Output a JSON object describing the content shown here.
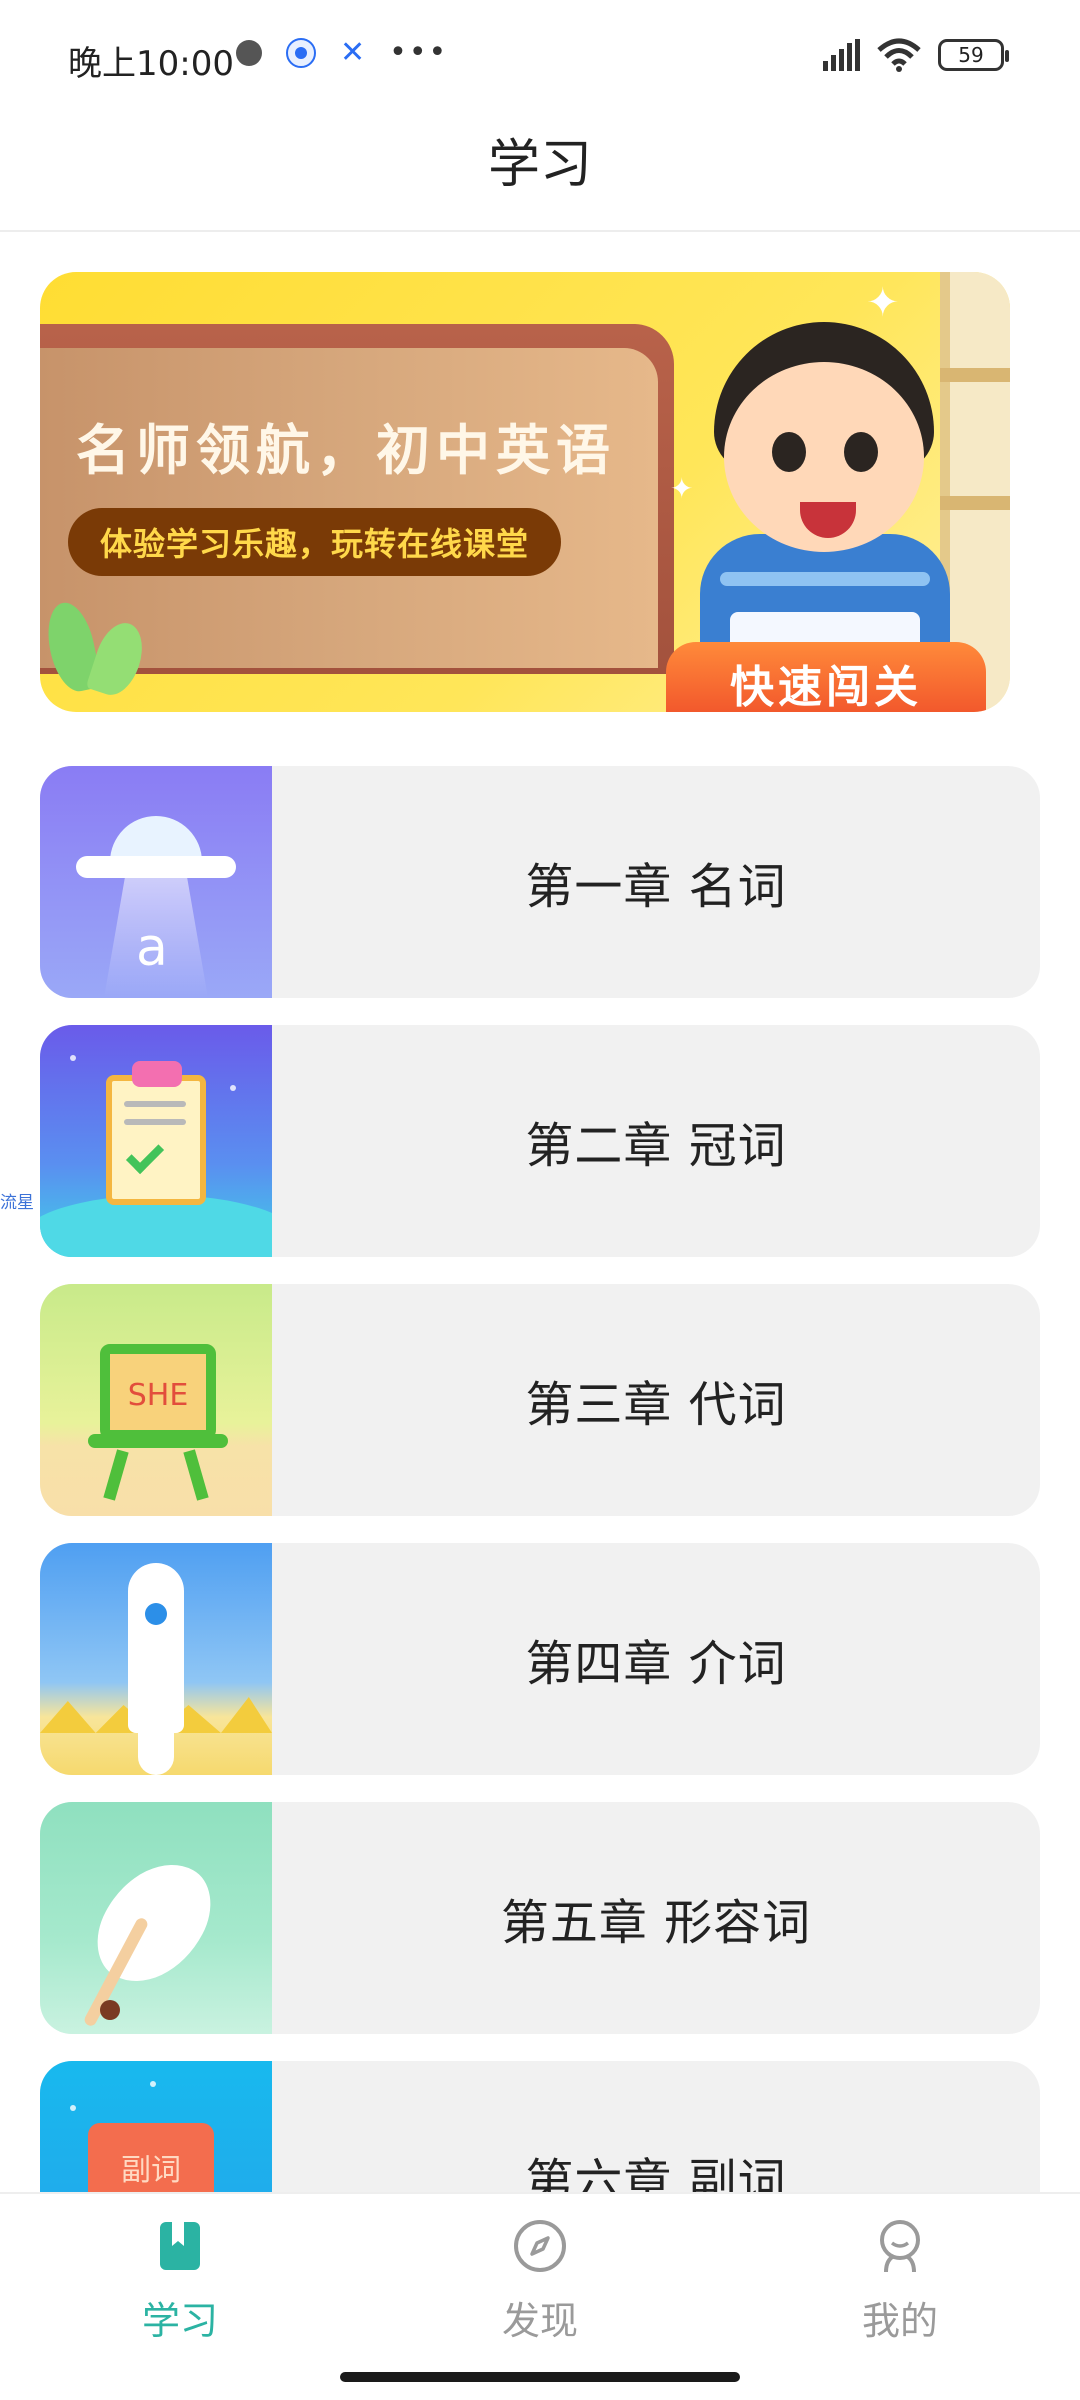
{
  "status_bar": {
    "time": "晚上10:00",
    "battery": "59",
    "icons": [
      "camera-dot-icon",
      "baidu-paw-icon",
      "x-app-icon",
      "more-dots-icon",
      "hd-signal-icon",
      "wifi-icon",
      "battery-icon"
    ]
  },
  "header": {
    "title": "学习"
  },
  "banner": {
    "title": "名师领航，初中英语",
    "subtitle": "体验学习乐趣，玩转在线课堂",
    "button_label": "快速闯关",
    "colors": {
      "background": "#ffdd33",
      "board": "#a3523d",
      "pill": "#7a3a06",
      "button": "#f0502a"
    }
  },
  "chapters": [
    {
      "label": "第一章 名词",
      "thumb_text": "a"
    },
    {
      "label": "第二章 冠词",
      "thumb_text": ""
    },
    {
      "label": "第三章 代词",
      "thumb_text": "SHE"
    },
    {
      "label": "第四章 介词",
      "thumb_text": ""
    },
    {
      "label": "第五章 形容词",
      "thumb_text": ""
    },
    {
      "label": "第六章 副词",
      "thumb_text": "副词"
    }
  ],
  "side_watermark": "流星",
  "bottom_nav": {
    "items": [
      {
        "label": "学习",
        "icon": "book-icon",
        "active": true
      },
      {
        "label": "发现",
        "icon": "compass-icon",
        "active": false
      },
      {
        "label": "我的",
        "icon": "person-icon",
        "active": false
      }
    ],
    "accent_color": "#2bb3a3",
    "inactive_color": "#9a9a9a"
  }
}
